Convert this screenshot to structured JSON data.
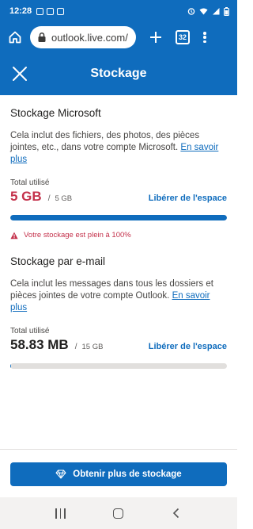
{
  "status_bar": {
    "time": "12:28"
  },
  "browser": {
    "url": "outlook.live.com/",
    "tab_count": "32"
  },
  "header": {
    "title": "Stockage"
  },
  "microsoft_storage": {
    "title": "Stockage Microsoft",
    "description": "Cela inclut des fichiers, des photos, des pièces jointes, etc., dans votre compte Microsoft.",
    "learn_more": "En savoir plus",
    "total_label": "Total utilisé",
    "used": "5 GB",
    "separator": "/",
    "total": "5 GB",
    "free_space": "Libérer de l'espace",
    "progress_fraction": 1.0,
    "warning": "Votre stockage est plein à 100%"
  },
  "email_storage": {
    "title": "Stockage par e-mail",
    "description": "Cela inclut les messages dans tous les dossiers et pièces jointes de votre compte Outlook.",
    "learn_more": "En savoir plus",
    "total_label": "Total utilisé",
    "used": "58.83 MB",
    "separator": "/",
    "total": "15 GB",
    "free_space": "Libérer de l'espace",
    "progress_fraction": 0.0038
  },
  "footer": {
    "cta_label": "Obtenir plus de stockage"
  },
  "colors": {
    "accent": "#0f6cbd",
    "warning": "#c4314b",
    "track": "#e1dfdd"
  }
}
